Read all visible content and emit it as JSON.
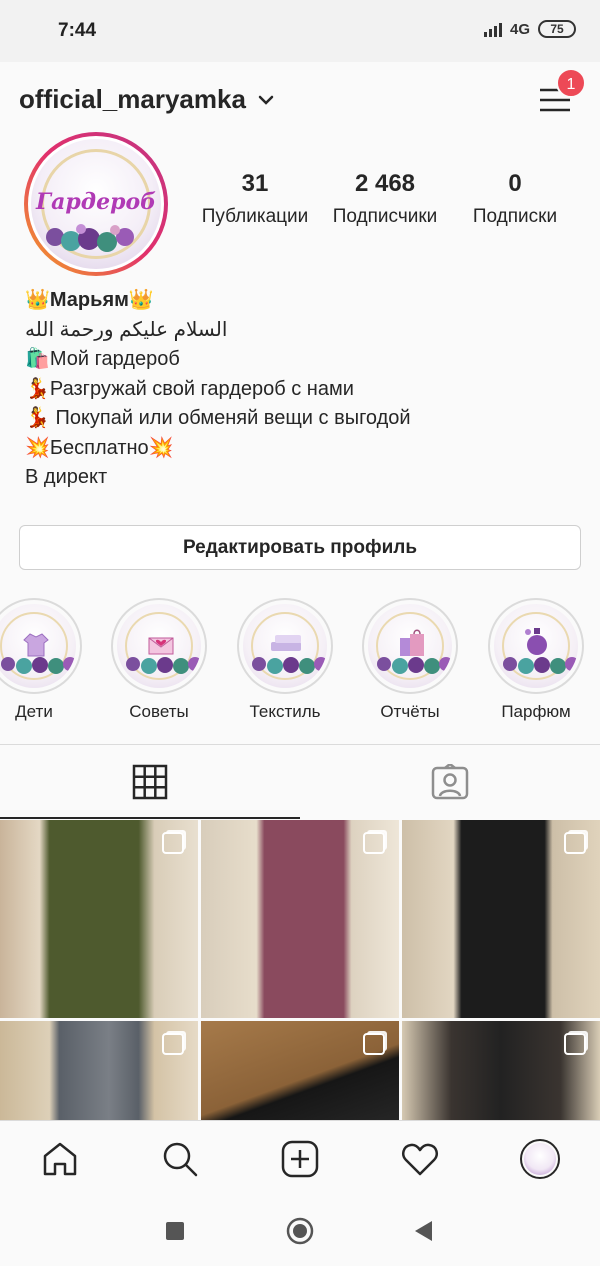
{
  "status_bar": {
    "time": "7:44",
    "network": "4G",
    "battery": "75"
  },
  "header": {
    "username": "official_maryamka",
    "notification_count": "1"
  },
  "profile": {
    "avatar_text": "Гардероб",
    "stats": [
      {
        "value": "31",
        "label": "Публикации"
      },
      {
        "value": "2 468",
        "label": "Подписчики"
      },
      {
        "value": "0",
        "label": "Подписки"
      }
    ],
    "bio": {
      "name": "👑Марьям👑",
      "line_arabic": "السلام عليكم ورحمة الله",
      "line1": "🛍️Мой гардероб",
      "line2": "💃Разгружай свой гардероб с нами",
      "line3": "💃 Покупай или обменяй вещи с выгодой",
      "line4": "💥Бесплатно💥",
      "line5": "В директ"
    },
    "edit_button": "Редактировать профиль"
  },
  "highlights": [
    {
      "label": "Дети",
      "icon": "jacket-icon"
    },
    {
      "label": "Советы",
      "icon": "envelope-heart-icon"
    },
    {
      "label": "Текстиль",
      "icon": "towels-icon"
    },
    {
      "label": "Отчёты",
      "icon": "shopping-bags-icon"
    },
    {
      "label": "Парфюм",
      "icon": "perfume-icon"
    }
  ],
  "tabs": [
    {
      "name": "grid-tab",
      "icon": "grid-icon",
      "active": true
    },
    {
      "name": "tagged-tab",
      "icon": "tagged-person-icon",
      "active": false
    }
  ],
  "grid_posts": [
    {
      "desc": "olive vest",
      "color": "#4e5a2e",
      "multi": true
    },
    {
      "desc": "mauve dress",
      "color": "#8a4a5e",
      "multi": true
    },
    {
      "desc": "black dress",
      "color": "#1c1c1c",
      "multi": true
    },
    {
      "desc": "plaid coat",
      "color": "#5a6068",
      "multi": true
    },
    {
      "desc": "black shoes",
      "color": "#161616",
      "multi": true
    },
    {
      "desc": "black lace",
      "color": "#222222",
      "multi": true
    }
  ],
  "bottom_nav": [
    "home-icon",
    "search-icon",
    "new-post-icon",
    "activity-heart-icon",
    "profile-avatar-icon"
  ],
  "colors": {
    "accent": "#ed4956",
    "text": "#262626",
    "border": "#dbdbdb"
  }
}
